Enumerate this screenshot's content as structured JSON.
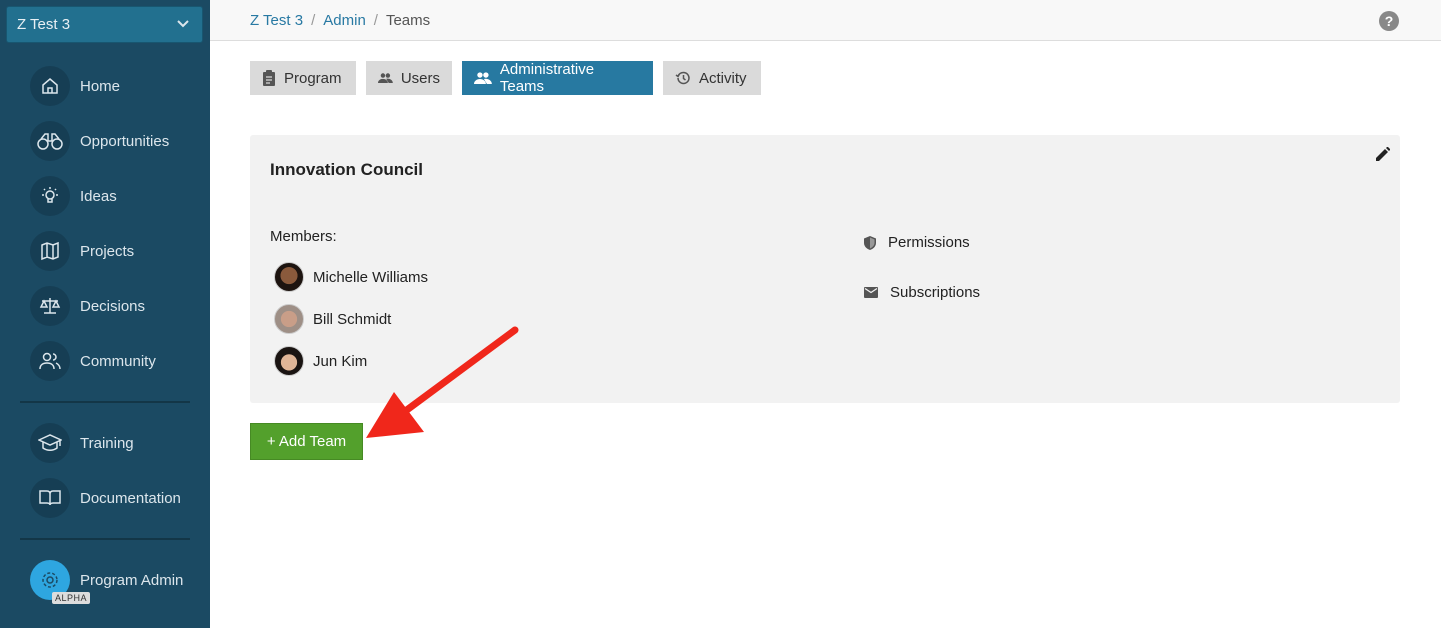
{
  "sidebar": {
    "program": "Z Test 3",
    "items": [
      {
        "label": "Home",
        "icon": "home-icon"
      },
      {
        "label": "Opportunities",
        "icon": "binoculars-icon"
      },
      {
        "label": "Ideas",
        "icon": "lightbulb-icon"
      },
      {
        "label": "Projects",
        "icon": "map-icon"
      },
      {
        "label": "Decisions",
        "icon": "scale-icon"
      },
      {
        "label": "Community",
        "icon": "people-icon"
      },
      {
        "label": "Training",
        "icon": "graduation-cap-icon"
      },
      {
        "label": "Documentation",
        "icon": "book-icon"
      }
    ],
    "admin": {
      "label": "Program Admin",
      "badge": "ALPHA"
    }
  },
  "breadcrumb": {
    "items": [
      "Z Test 3",
      "Admin",
      "Teams"
    ]
  },
  "tabs": [
    {
      "label": "Program"
    },
    {
      "label": "Users"
    },
    {
      "label": "Administrative Teams"
    },
    {
      "label": "Activity"
    }
  ],
  "team": {
    "name": "Innovation Council",
    "members_label": "Members:",
    "members": [
      "Michelle Williams",
      "Bill Schmidt",
      "Jun Kim"
    ],
    "links": [
      "Permissions",
      "Subscriptions"
    ]
  },
  "add_team": "+ Add Team",
  "colors": {
    "sidebar": "#1b4a63",
    "accent": "#2779a1",
    "add": "#53a02c",
    "arrow": "#f0271b"
  }
}
